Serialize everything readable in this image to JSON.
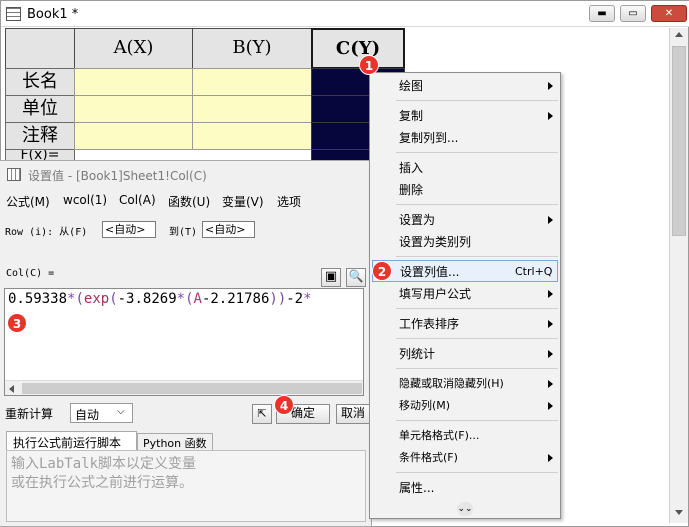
{
  "book": {
    "title": "Book1 *",
    "window_controls": {
      "minimize": "▬",
      "maximize": "▭",
      "close": "✕"
    }
  },
  "sheet": {
    "columns": [
      "A(X)",
      "B(Y)",
      "C(Y)"
    ],
    "row_labels": [
      "长名",
      "单位",
      "注释",
      "F(x)="
    ]
  },
  "dialog": {
    "title": "设置值 - [Book1]Sheet1!Col(C)",
    "menus": [
      "公式(M)",
      "wcol(1)",
      "Col(A)",
      "函数(U)",
      "变量(V)",
      "选项"
    ],
    "row_label": "Row (i): 从(F)",
    "from_value": "<自动>",
    "to_label": "到(T)",
    "to_value": "<自动>",
    "col_label": "Col(C) =",
    "formula_parts": [
      {
        "text": "0.59338",
        "color": "#000000"
      },
      {
        "text": "*",
        "color": "#7a4aa8"
      },
      {
        "text": "(",
        "color": "#7a4aa8"
      },
      {
        "text": "exp",
        "color": "#a0305a"
      },
      {
        "text": "(",
        "color": "#7a4aa8"
      },
      {
        "text": "-3.8269",
        "color": "#000000"
      },
      {
        "text": "*",
        "color": "#7a4aa8"
      },
      {
        "text": "(",
        "color": "#7a4aa8"
      },
      {
        "text": "A",
        "color": "#c0307a"
      },
      {
        "text": "-2.21786",
        "color": "#000000"
      },
      {
        "text": "))",
        "color": "#7a4aa8"
      },
      {
        "text": "-2",
        "color": "#000000"
      },
      {
        "text": "*",
        "color": "#7a4aa8"
      }
    ],
    "recalc_label": "重新计算",
    "recalc_value": "自动",
    "ok_label": "确定",
    "cancel_label": "取消",
    "tabs": [
      "执行公式前运行脚本",
      "Python 函数"
    ],
    "script_placeholder_line1": "输入LabTalk脚本以定义变量",
    "script_placeholder_line2": "或在执行公式之前进行运算。"
  },
  "context_menu": {
    "items": [
      {
        "label": "绘图",
        "submenu": true
      },
      {
        "label": "复制",
        "submenu": true
      },
      {
        "label": "复制列到...",
        "submenu": false
      },
      {
        "label": "插入",
        "submenu": false
      },
      {
        "label": "删除",
        "submenu": false
      },
      {
        "label": "设置为",
        "submenu": true
      },
      {
        "label": "设置为类别列",
        "submenu": false
      },
      {
        "label": "设置列值...",
        "submenu": false,
        "shortcut": "Ctrl+Q",
        "highlighted": true
      },
      {
        "label": "填写用户公式",
        "submenu": true
      },
      {
        "label": "工作表排序",
        "submenu": true
      },
      {
        "label": "列统计",
        "submenu": true
      },
      {
        "label": "隐藏或取消隐藏列(H)",
        "submenu": true
      },
      {
        "label": "移动列(M)",
        "submenu": true
      },
      {
        "label": "单元格格式(F)...",
        "submenu": false
      },
      {
        "label": "条件格式(F)",
        "submenu": true
      },
      {
        "label": "属性...",
        "submenu": false
      }
    ],
    "more_icon": "double-chevron-down"
  },
  "badges": [
    "1",
    "2",
    "3",
    "4"
  ],
  "colors": {
    "selected_column": "#06063d",
    "cell_fill": "#fdfcc4",
    "badge": "#e8352b"
  }
}
